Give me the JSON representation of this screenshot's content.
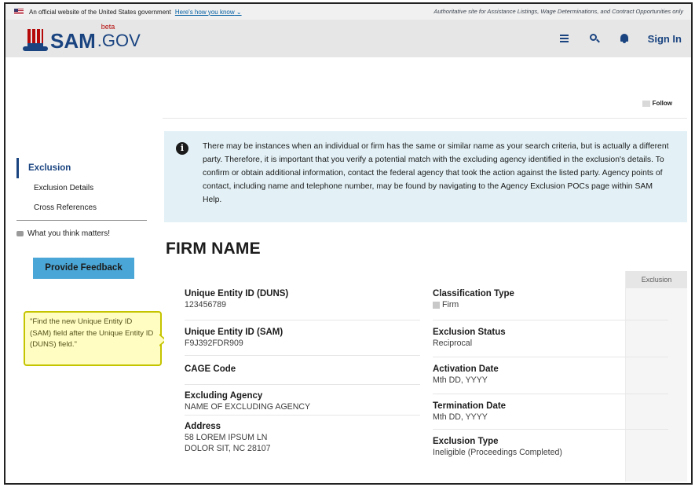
{
  "banner": {
    "text": "An official website of the United States government",
    "link": "Here's how you know",
    "chevron": "⌄",
    "right_text": "Authoritative site for Assistance Listings, Wage Determinations, and Contract Opportunities only"
  },
  "header": {
    "logo_sam": "SAM",
    "logo_beta": "beta",
    "logo_gov": ".GOV",
    "signin": "Sign In",
    "icons": [
      "menu-icon",
      "search-icon",
      "bell-icon"
    ]
  },
  "follow": {
    "label": "Follow"
  },
  "alert": {
    "icon": "i",
    "text": "There may be instances when an individual or firm has the same or similar name as your search criteria, but is actually a different party. Therefore, it is important that you verify a potential match with the excluding agency identified in the exclusion's details. To confirm or obtain additional information, contact the federal agency that took the action against the listed party. Agency points of contact, including name and telephone number, may be found by navigating to the Agency Exclusion POCs page within SAM Help."
  },
  "sidenav": {
    "active": "Exclusion",
    "items": [
      "Exclusion Details",
      "Cross References"
    ]
  },
  "feedback": {
    "note": "What you think matters!",
    "button": "Provide Feedback"
  },
  "callout": {
    "text": "\"Find the new Unique Entity ID (SAM) field after the Unique Entity ID (DUNS) field.\""
  },
  "firm": {
    "title": "FIRM NAME",
    "tab": "Exclusion",
    "left_fields": [
      {
        "label": "Unique Entity ID (DUNS)",
        "value": "123456789"
      },
      {
        "label": "Unique Entity ID (SAM)",
        "value": "F9J392FDR909"
      },
      {
        "label": "CAGE Code",
        "value": ""
      },
      {
        "label": "Excluding Agency",
        "value": "NAME OF EXCLUDING AGENCY"
      },
      {
        "label": "Address",
        "value": "58 LOREM IPSUM LN",
        "value2": "DOLOR SIT, NC 28107"
      }
    ],
    "right_fields": [
      {
        "label": "Classification Type",
        "value": "Firm"
      },
      {
        "label": "Exclusion Status",
        "value": "Reciprocal"
      },
      {
        "label": "Activation Date",
        "value": "Mth DD, YYYY"
      },
      {
        "label": "Termination Date",
        "value": "Mth DD, YYYY"
      },
      {
        "label": "Exclusion Type",
        "value": "Ineligible (Proceedings Completed)"
      }
    ]
  },
  "colors": {
    "primary": "#1a4480",
    "brand_red": "#b50909",
    "alert_bg": "#e3f1f6",
    "feedback_btn": "#4aa6d6",
    "callout_bg": "#fffdc2",
    "callout_border": "#c5c400"
  }
}
